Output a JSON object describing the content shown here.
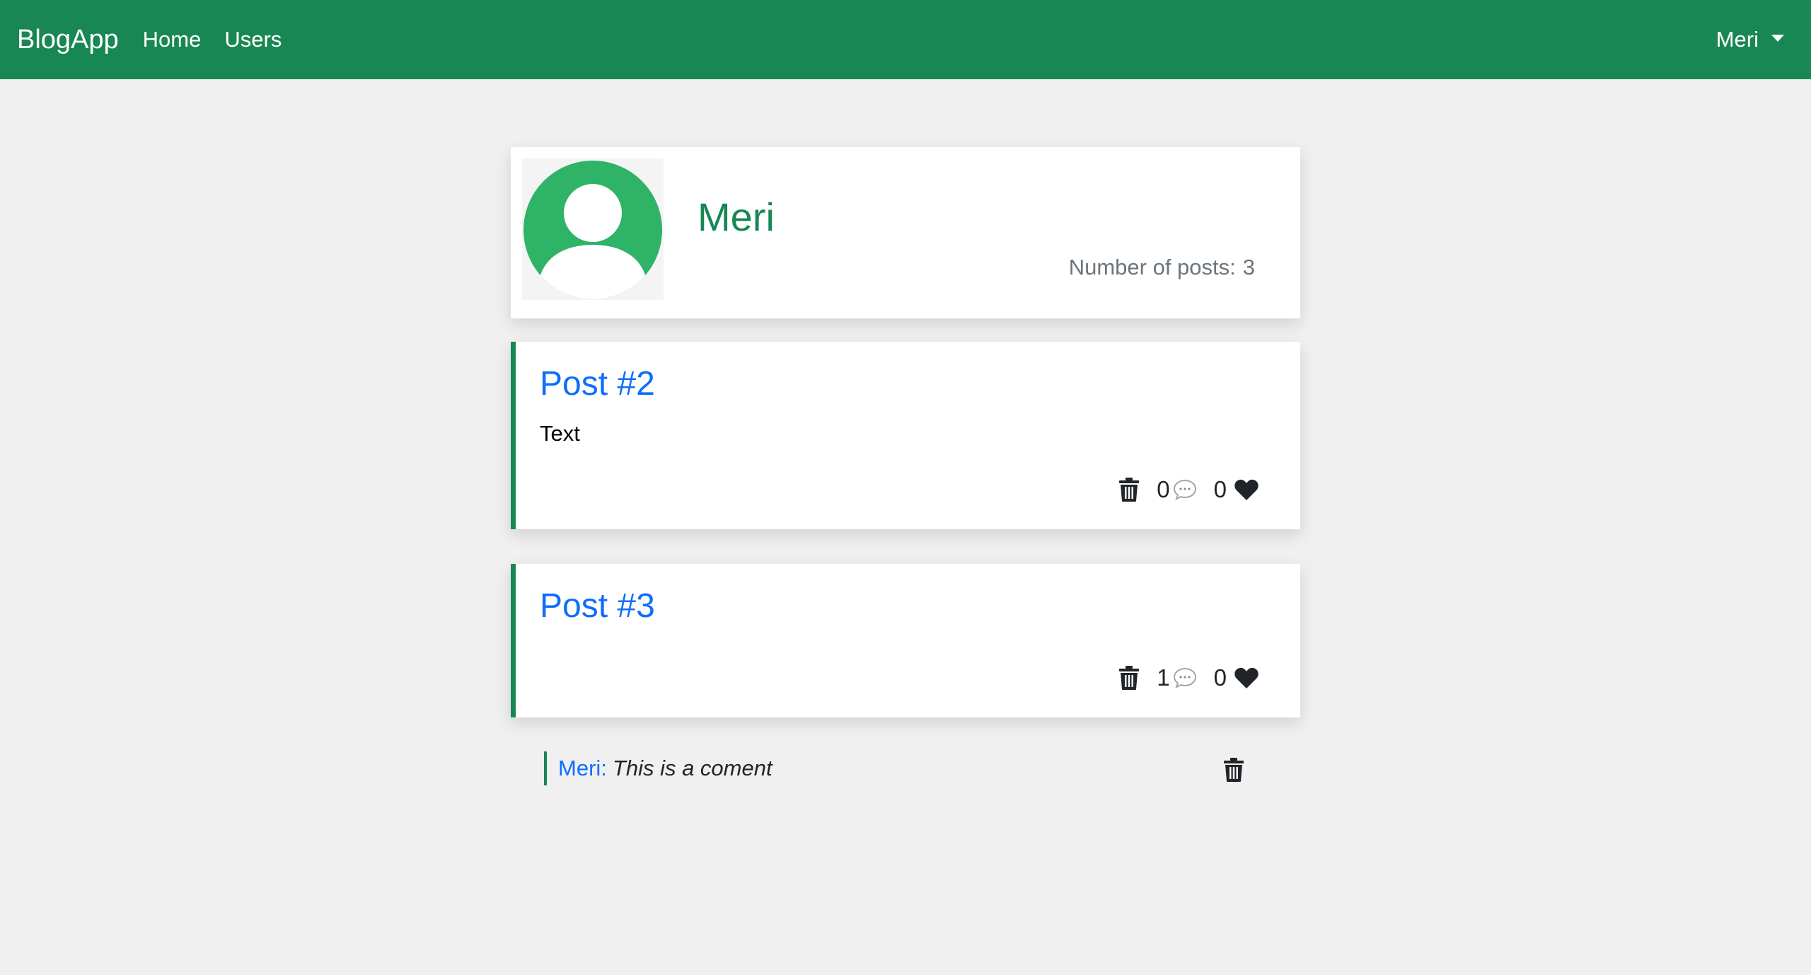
{
  "navbar": {
    "brand": "BlogApp",
    "links": [
      "Home",
      "Users"
    ],
    "user_menu": "Meri"
  },
  "profile": {
    "name": "Meri",
    "posts_label": "Number of posts:",
    "posts_count": "3"
  },
  "posts": [
    {
      "title": "Post #2",
      "text": "Text",
      "comments": "0",
      "likes": "0"
    },
    {
      "title": "Post #3",
      "text": "",
      "comments": "1",
      "likes": "0"
    }
  ],
  "comments": [
    {
      "author": "Meri:",
      "text": "This is a coment"
    }
  ],
  "colors": {
    "primary_green": "#198754",
    "avatar_green": "#2fb366",
    "link_blue": "#0d6efd",
    "background": "#f0f0f0"
  },
  "icons": [
    "trash-icon",
    "comment-bubble-icon",
    "heart-icon",
    "user-avatar-icon",
    "caret-down-icon"
  ]
}
